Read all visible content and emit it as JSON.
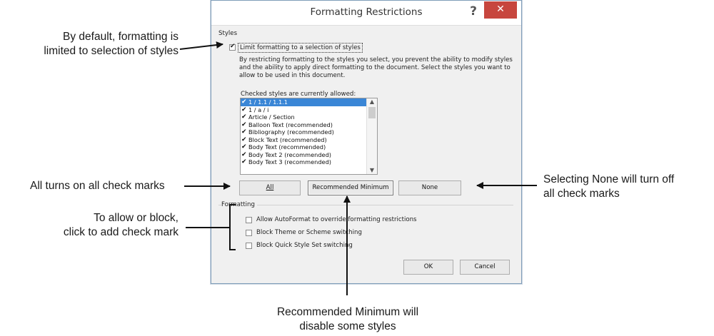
{
  "dialog": {
    "title": "Formatting Restrictions",
    "help": "?",
    "close": "✕",
    "styles_section": "Styles",
    "limit_checkbox_label": "Limit formatting to a selection of styles",
    "limit_checked": true,
    "description": "By restricting formatting to the styles you select, you prevent the ability to modify styles and the ability to apply direct formatting to the document. Select the styles you want to allow to be used in this document.",
    "list_caption": "Checked styles are currently allowed:",
    "styles": [
      {
        "label": "1 / 1.1 / 1.1.1",
        "checked": true,
        "selected": true
      },
      {
        "label": "1 / a / i",
        "checked": true,
        "selected": false
      },
      {
        "label": "Article / Section",
        "checked": true,
        "selected": false
      },
      {
        "label": "Balloon Text (recommended)",
        "checked": true,
        "selected": false
      },
      {
        "label": "Bibliography (recommended)",
        "checked": true,
        "selected": false
      },
      {
        "label": "Block Text (recommended)",
        "checked": true,
        "selected": false
      },
      {
        "label": "Body Text (recommended)",
        "checked": true,
        "selected": false
      },
      {
        "label": "Body Text 2 (recommended)",
        "checked": true,
        "selected": false
      },
      {
        "label": "Body Text 3 (recommended)",
        "checked": true,
        "selected": false
      }
    ],
    "buttons": {
      "all": "All",
      "recommended": "Recommended Minimum",
      "none": "None",
      "ok": "OK",
      "cancel": "Cancel"
    },
    "formatting_section": "Formatting",
    "formatting_options": [
      {
        "label": "Allow AutoFormat to override formatting restrictions",
        "checked": false
      },
      {
        "label": "Block Theme or Scheme switching",
        "checked": false
      },
      {
        "label": "Block Quick Style Set switching",
        "checked": false
      }
    ]
  },
  "callouts": {
    "default_line1": "By default, formatting is",
    "default_line2": "limited to selection of styles",
    "all": "All turns on all check marks",
    "allow_line1": "To allow or block,",
    "allow_line2": "click to add check mark",
    "none_line1": "Selecting None will turn off",
    "none_line2": "all check marks",
    "recommended_line1": "Recommended Minimum will",
    "recommended_line2": "disable some styles"
  },
  "colors": {
    "close_button": "#c7463e",
    "selection": "#3a86d6",
    "dialog_body": "#f0f0f0"
  }
}
